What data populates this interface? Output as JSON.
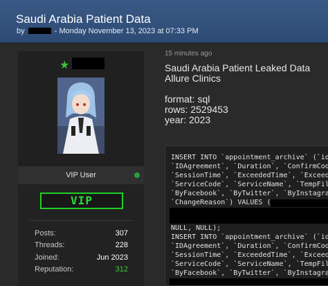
{
  "thread": {
    "title": "Saudi Arabia Patient Data",
    "by_prefix": "by",
    "byline_rest": " - Monday November 13, 2023 at 07:33 PM"
  },
  "user": {
    "rank": "VIP User",
    "badge": "VIP",
    "stats": [
      {
        "label": "Posts:",
        "value": "307"
      },
      {
        "label": "Threads:",
        "value": "228"
      },
      {
        "label": "Joined:",
        "value": "Jun 2023"
      },
      {
        "label": "Reputation:",
        "value": "312"
      }
    ],
    "reputation_color": "#3ccb3c",
    "online_color": "#2e9c3d",
    "star_icon": "star-icon"
  },
  "post": {
    "time": "15 minutes ago",
    "lines": [
      "Saudi Arabia Patient Leaked Data",
      "Allure Clinics",
      "",
      "format: sql",
      "rows: 2529453",
      "year: 2023"
    ]
  },
  "code": {
    "lines": [
      "INSERT INTO `appointment_archive` (`id",
      "`IDAgreement`, `Duration`, `ConfirmCod",
      "`SessionTime`, `ExceededTime`, `Exceed",
      "`ServiceCode`, `ServiceName`, `TempFil",
      "`ByFacebook`, `ByTwitter`, `ByInstagra",
      "`ChangeReason`) VALUES (",
      "",
      "NULL, NULL);",
      "INSERT INTO `appointment_archive` (`id",
      "`IDAgreement`, `Duration`, `ConfirmCod",
      "`SessionTime`, `ExceededTime`, `Exceed",
      "`ServiceCode`, `ServiceName`, `TempFil",
      "`ByFacebook`, `ByTwitter`, `ByInstagra"
    ]
  },
  "theme": {
    "header_blue": "#2c4a74",
    "vip_green": "#29dd35"
  }
}
